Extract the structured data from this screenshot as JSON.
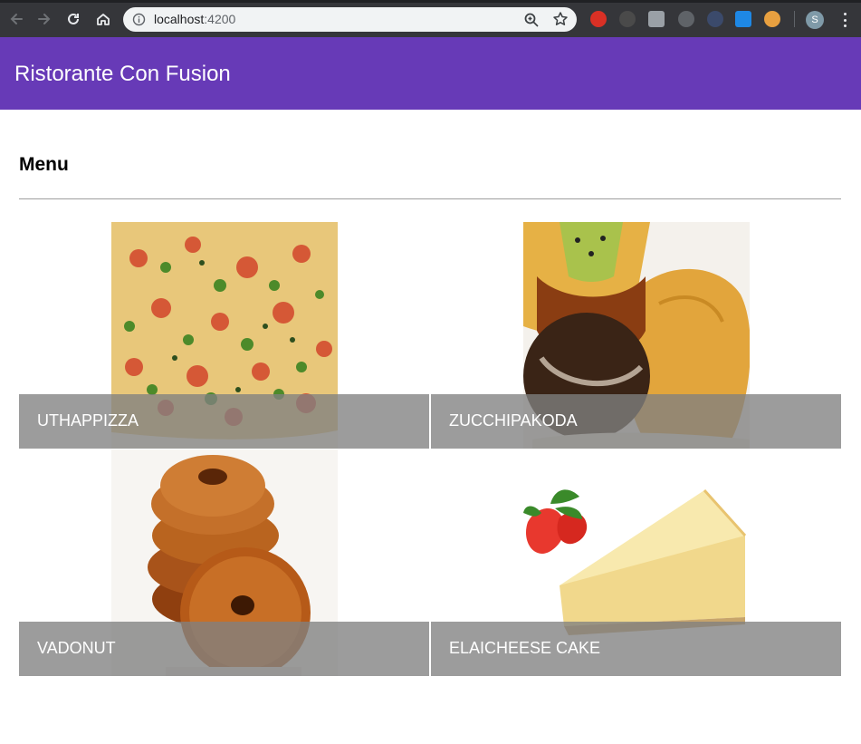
{
  "browser": {
    "url_host": "localhost",
    "url_port": ":4200",
    "profile_initial": "S",
    "icons": [
      "back-icon",
      "forward-icon",
      "reload-icon",
      "home-icon",
      "info-icon",
      "zoom-icon",
      "bookmark-star-icon",
      "kebab-menu-icon"
    ]
  },
  "toolbar": {
    "title": "Ristorante Con Fusion",
    "color": "#673ab7"
  },
  "main": {
    "heading": "Menu",
    "dishes": [
      {
        "name": "UTHAPPIZZA"
      },
      {
        "name": "ZUCCHIPAKODA"
      },
      {
        "name": "VADONUT"
      },
      {
        "name": "ELAICHEESE CAKE"
      }
    ]
  }
}
